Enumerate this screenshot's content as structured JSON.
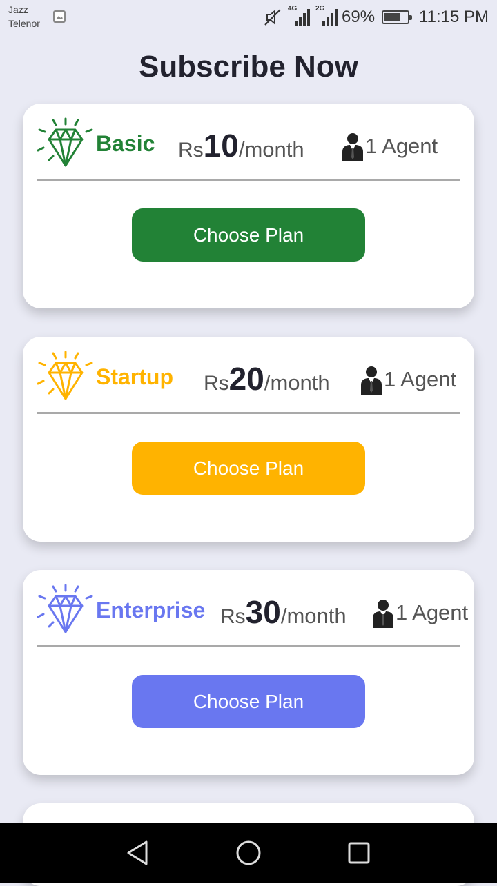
{
  "status_bar": {
    "carrier_line1": "Jazz",
    "carrier_line2": "Telenor",
    "net1": "4G",
    "net2": "2G",
    "battery": "69%",
    "battery_level": 0.69,
    "time": "11:15 PM"
  },
  "title": "Subscribe Now",
  "plans": [
    {
      "name": "Basic",
      "currency": "Rs",
      "amount": "10",
      "period": "/month",
      "agents": "1 Agent",
      "button": "Choose Plan",
      "color": "#228236"
    },
    {
      "name": "Startup",
      "currency": "Rs",
      "amount": "20",
      "period": "/month",
      "agents": "1 Agent",
      "button": "Choose Plan",
      "color": "#ffb300"
    },
    {
      "name": "Enterprise",
      "currency": "Rs",
      "amount": "30",
      "period": "/month",
      "agents": "1 Agent",
      "button": "Choose Plan",
      "color": "#6977f0"
    }
  ],
  "icons": {
    "plan": "diamond-icon",
    "agent": "agent-icon",
    "nav_back": "back-icon",
    "nav_home": "home-icon",
    "nav_recents": "recents-icon"
  }
}
